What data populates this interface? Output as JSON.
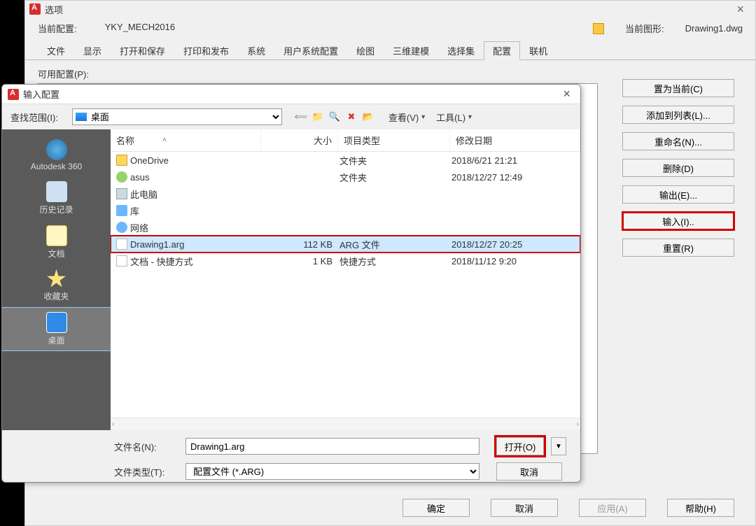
{
  "options": {
    "title": "选项",
    "close": "×",
    "profile_label": "当前配置:",
    "profile_value": "YKY_MECH2016",
    "drawing_label": "当前图形:",
    "drawing_value": "Drawing1.dwg",
    "tabs": [
      "文件",
      "显示",
      "打开和保存",
      "打印和发布",
      "系统",
      "用户系统配置",
      "绘图",
      "三维建模",
      "选择集",
      "配置",
      "联机"
    ],
    "active_tab": 9,
    "avail_label": "可用配置(P):",
    "buttons": {
      "set_current": "置为当前(C)",
      "add_to_list": "添加到列表(L)...",
      "rename": "重命名(N)...",
      "delete": "删除(D)",
      "export": "输出(E)...",
      "import": "输入(I)..",
      "reset": "重置(R)"
    },
    "bottom": {
      "ok": "确定",
      "cancel": "取消",
      "apply": "应用(A)",
      "help": "帮助(H)"
    }
  },
  "file": {
    "title": "输入配置",
    "close": "×",
    "look_in_label": "查找范围(I):",
    "location": "桌面",
    "view_menu": "查看(V)",
    "tools_menu": "工具(L)",
    "toolbar_icons": {
      "back_arrow": "back-arrow",
      "up": "up-folder",
      "search": "search",
      "delete": "delete-x",
      "new_folder": "new-folder"
    },
    "sidebar": [
      {
        "label": "Autodesk 360",
        "icon": "cloud"
      },
      {
        "label": "历史记录",
        "icon": "history"
      },
      {
        "label": "文档",
        "icon": "docs"
      },
      {
        "label": "收藏夹",
        "icon": "fav"
      },
      {
        "label": "桌面",
        "icon": "desktop",
        "selected": true
      }
    ],
    "columns": {
      "name": "名称",
      "size": "大小",
      "type": "项目类型",
      "date": "修改日期"
    },
    "rows": [
      {
        "name": "OneDrive",
        "size": "",
        "type": "文件夹",
        "date": "2018/6/21 21:21",
        "icon": "folder"
      },
      {
        "name": "asus",
        "size": "",
        "type": "文件夹",
        "date": "2018/12/27 12:49",
        "icon": "user"
      },
      {
        "name": "此电脑",
        "size": "",
        "type": "",
        "date": "",
        "icon": "pc"
      },
      {
        "name": "库",
        "size": "",
        "type": "",
        "date": "",
        "icon": "lib"
      },
      {
        "name": "网络",
        "size": "",
        "type": "",
        "date": "",
        "icon": "net"
      },
      {
        "name": "Drawing1.arg",
        "size": "112 KB",
        "type": "ARG 文件",
        "date": "2018/12/27 20:25",
        "icon": "file",
        "selected": true,
        "boxed": true
      },
      {
        "name": "文档 - 快捷方式",
        "size": "1 KB",
        "type": "快捷方式",
        "date": "2018/11/12 9:20",
        "icon": "file"
      }
    ],
    "filename_label": "文件名(N):",
    "filename_value": "Drawing1.arg",
    "filetype_label": "文件类型(T):",
    "filetype_value": "配置文件 (*.ARG)",
    "open_btn": "打开(O)",
    "cancel_btn": "取消"
  }
}
